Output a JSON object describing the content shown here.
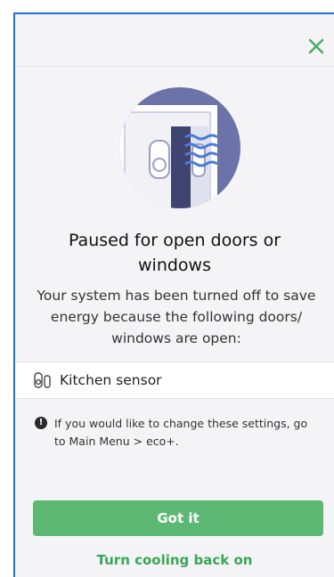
{
  "dialog": {
    "title": "Paused for open doors or windows",
    "description": "Your system has been turned off to save energy because the following doors/ windows are open:",
    "sensors": [
      {
        "label": "Kitchen sensor",
        "icon": "door-window-sensor-icon"
      }
    ],
    "info_text": "If you would like to change these settings, go to Main Menu > eco+.",
    "primary_button": "Got it",
    "secondary_link": "Turn cooling back on",
    "close_icon": "close-icon"
  },
  "colors": {
    "accent_green": "#5cb872",
    "link_green": "#3aa655",
    "illustration_circle": "#6b73a8",
    "background": "#f4f4f6"
  }
}
